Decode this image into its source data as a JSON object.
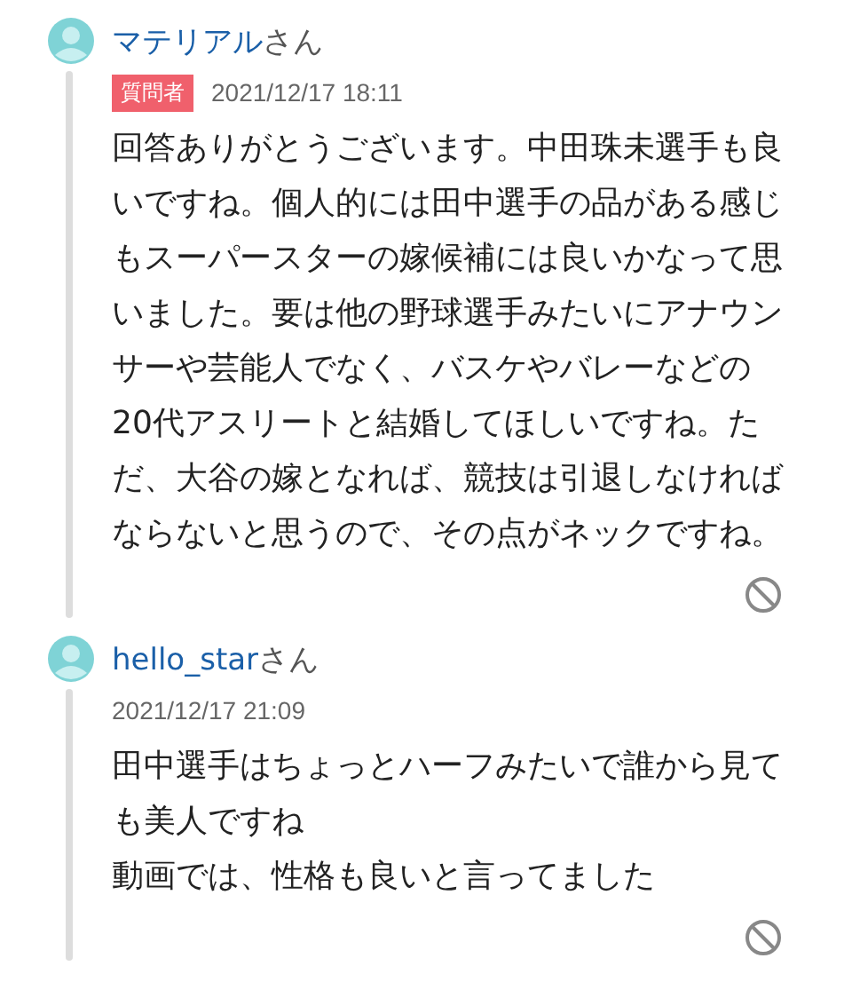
{
  "answers": [
    {
      "user": "マテリアル",
      "suffix": "さん",
      "badge": "質問者",
      "date": "2021/12/17 18:11",
      "paragraphs": [
        "回答ありがとうございます。中田珠未選手も良いですね。個人的には田中選手の品がある感じもスーパースターの嫁候補には良いかなって思いました。要は他の野球選手みたいにアナウンサーや芸能人でなく、バスケやバレーなどの20代アスリートと結婚してほしいですね。ただ、大谷の嫁となれば、競技は引退しなければならないと思うので、その点がネックですね。"
      ]
    },
    {
      "user": "hello_star",
      "suffix": "さん",
      "date": "2021/12/17 21:09",
      "paragraphs": [
        "田中選手はちょっとハーフみたいで誰から見ても美人ですね",
        "動画では、性格も良いと言ってました"
      ]
    }
  ]
}
